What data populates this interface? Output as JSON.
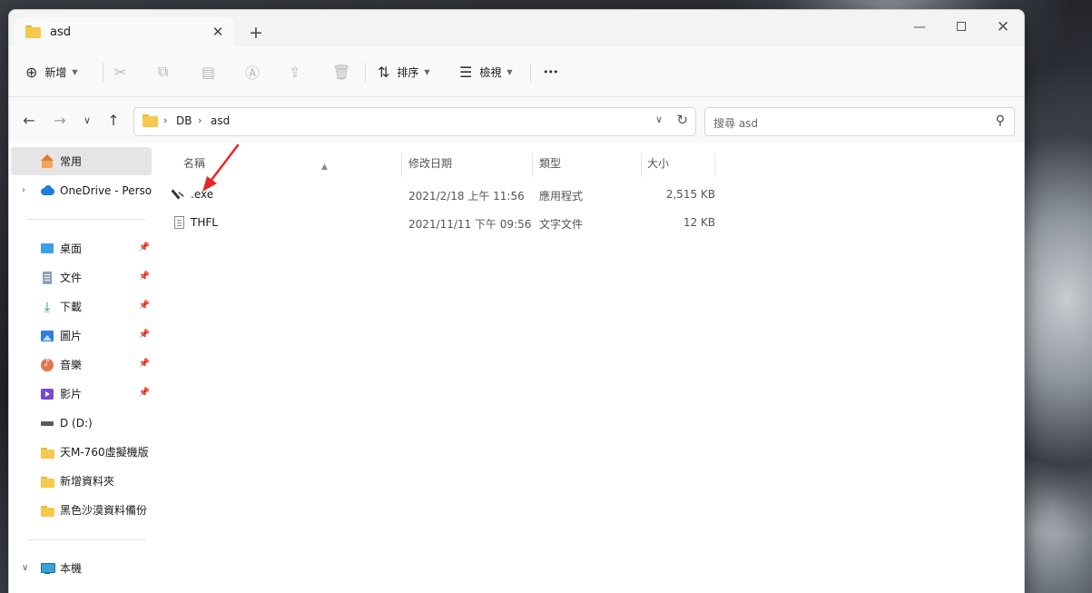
{
  "window": {
    "tab_title": "asd",
    "tab_close": "✕",
    "new_tab": "+",
    "controls": {
      "minimize": "—",
      "close": "✕"
    }
  },
  "toolbar": {
    "new_label": "新增",
    "sort_label": "排序",
    "view_label": "檢視",
    "more": "•••"
  },
  "address": {
    "crumbs": [
      "DB",
      "asd"
    ],
    "separator": "›"
  },
  "search": {
    "placeholder": "搜尋 asd"
  },
  "sidebar": {
    "home": "常用",
    "onedrive": "OneDrive - Person",
    "quick_access": [
      {
        "label": "桌面",
        "icon": "desktop-icon"
      },
      {
        "label": "文件",
        "icon": "documents-icon"
      },
      {
        "label": "下載",
        "icon": "download-icon"
      },
      {
        "label": "圖片",
        "icon": "pictures-icon"
      },
      {
        "label": "音樂",
        "icon": "music-icon"
      },
      {
        "label": "影片",
        "icon": "videos-icon"
      },
      {
        "label": "D (D:)",
        "icon": "drive-icon"
      },
      {
        "label": "天M-760虛擬機版",
        "icon": "folder-icon"
      },
      {
        "label": "新增資料夾",
        "icon": "folder-icon"
      },
      {
        "label": "黑色沙漠資料備份",
        "icon": "folder-icon"
      }
    ],
    "this_pc": "本機"
  },
  "columns": {
    "name": "名稱",
    "date": "修改日期",
    "type": "類型",
    "size": "大小"
  },
  "files": [
    {
      "name": ".exe",
      "date": "2021/2/18 上午 11:56",
      "type": "應用程式",
      "size": "2,515 KB",
      "icon": "executable-icon"
    },
    {
      "name": "THFL",
      "date": "2021/11/11 下午 09:56",
      "type": "文字文件",
      "size": "12 KB",
      "icon": "text-file-icon"
    }
  ],
  "colors": {
    "accent": "#0067c0",
    "annotation_arrow": "#e8262a"
  }
}
